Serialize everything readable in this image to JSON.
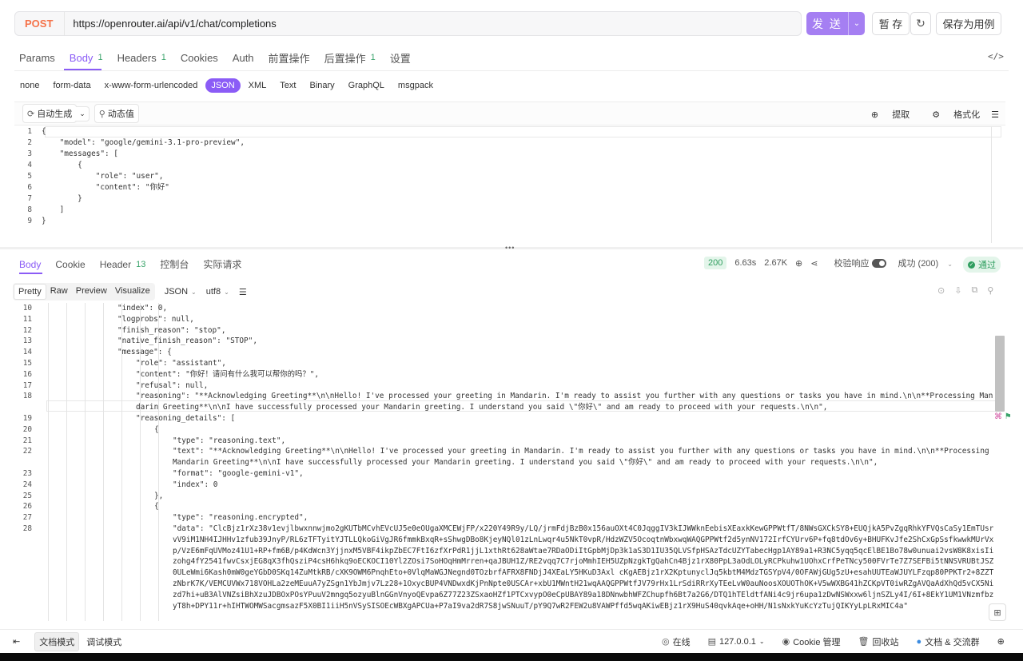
{
  "request": {
    "method": "POST",
    "url": "https://openrouter.ai/api/v1/chat/completions",
    "send_label": "发 送",
    "save_label": "暂 存",
    "save_as_label": "保存为用例"
  },
  "request_tabs": [
    {
      "label": "Params",
      "badge": ""
    },
    {
      "label": "Body",
      "badge": "1"
    },
    {
      "label": "Headers",
      "badge": "1"
    },
    {
      "label": "Cookies",
      "badge": ""
    },
    {
      "label": "Auth",
      "badge": ""
    },
    {
      "label": "前置操作",
      "badge": ""
    },
    {
      "label": "后置操作",
      "badge": "1"
    },
    {
      "label": "设置",
      "badge": ""
    }
  ],
  "body_types": [
    "none",
    "form-data",
    "x-www-form-urlencoded",
    "JSON",
    "XML",
    "Text",
    "Binary",
    "GraphQL",
    "msgpack"
  ],
  "editor_toolbar": {
    "auto_generate": "自动生成",
    "dynamic_value": "动态值",
    "extract": "提取",
    "format": "格式化"
  },
  "request_body_lines": [
    {
      "n": "1",
      "code": "{"
    },
    {
      "n": "2",
      "code": "    \"model\": \"google/gemini-3.1-pro-preview\","
    },
    {
      "n": "3",
      "code": "    \"messages\": ["
    },
    {
      "n": "4",
      "code": "        {"
    },
    {
      "n": "5",
      "code": "            \"role\": \"user\","
    },
    {
      "n": "6",
      "code": "            \"content\": \"你好\""
    },
    {
      "n": "7",
      "code": "        }"
    },
    {
      "n": "8",
      "code": "    ]"
    },
    {
      "n": "9",
      "code": "}"
    }
  ],
  "response_tabs": [
    {
      "label": "Body",
      "badge": ""
    },
    {
      "label": "Cookie",
      "badge": ""
    },
    {
      "label": "Header",
      "badge": "13"
    },
    {
      "label": "控制台",
      "badge": ""
    },
    {
      "label": "实际请求",
      "badge": ""
    }
  ],
  "response_meta": {
    "status": "200",
    "time": "6.63s",
    "size": "2.67K",
    "validate_label": "校验响应",
    "success_label": "成功 (200)",
    "pass_label": "通过"
  },
  "view_modes": [
    "Pretty",
    "Raw",
    "Preview",
    "Visualize"
  ],
  "format_select": "JSON",
  "encoding_select": "utf8",
  "response_lines": [
    {
      "n": "10",
      "indent": 5,
      "code": "\"index\": 0,"
    },
    {
      "n": "11",
      "indent": 5,
      "code": "\"logprobs\": null,"
    },
    {
      "n": "12",
      "indent": 5,
      "code": "\"finish_reason\": \"stop\","
    },
    {
      "n": "13",
      "indent": 5,
      "code": "\"native_finish_reason\": \"STOP\","
    },
    {
      "n": "14",
      "indent": 5,
      "code": "\"message\": {"
    },
    {
      "n": "15",
      "indent": 6,
      "code": "\"role\": \"assistant\","
    },
    {
      "n": "16",
      "indent": 6,
      "code": "\"content\": \"你好！请问有什么我可以帮你的吗？\","
    },
    {
      "n": "17",
      "indent": 6,
      "code": "\"refusal\": null,"
    },
    {
      "n": "18",
      "indent": 6,
      "code": "\"reasoning\": \"**Acknowledging Greeting**\\n\\nHello! I've processed your greeting in Mandarin. I'm ready to assist you further with any questions or tasks you have in mind.\\n\\n**Processing Mandarin Greeting**\\n\\nI have successfully processed your Mandarin greeting. I understand you said \\\"你好\\\" and am ready to proceed with your requests.\\n\\n\","
    },
    {
      "n": "19",
      "indent": 6,
      "code": "\"reasoning_details\": ["
    },
    {
      "n": "20",
      "indent": 7,
      "code": "{"
    },
    {
      "n": "21",
      "indent": 8,
      "code": "\"type\": \"reasoning.text\","
    },
    {
      "n": "22",
      "indent": 8,
      "code": "\"text\": \"**Acknowledging Greeting**\\n\\nHello! I've processed your greeting in Mandarin. I'm ready to assist you further with any questions or tasks you have in mind.\\n\\n**Processing Mandarin Greeting**\\n\\nI have successfully processed your Mandarin greeting. I understand you said \\\"你好\\\" and am ready to proceed with your requests.\\n\\n\","
    },
    {
      "n": "23",
      "indent": 8,
      "code": "\"format\": \"google-gemini-v1\","
    },
    {
      "n": "24",
      "indent": 8,
      "code": "\"index\": 0"
    },
    {
      "n": "25",
      "indent": 7,
      "code": "},"
    },
    {
      "n": "26",
      "indent": 7,
      "code": "{"
    },
    {
      "n": "27",
      "indent": 8,
      "code": "\"type\": \"reasoning.encrypted\","
    },
    {
      "n": "28",
      "indent": 8,
      "code": "\"data\": \"ClcBjz1rXz38v1evjlbwxnnwjmo2gKUTbMCvhEVcUJ5e0eOUgaXMCEWjFP/x220Y49R9y/LQ/jrmFdjBzB0x156auOXt4C0JqggIV3kIJWWknEebisXEaxkKewGPPWtfT/8NWsGXCkSY8+EUQjkA5PvZgqRhkYFVQsCaSy1EmTUsrvV9iM1NH4IJHHv1zfub39JnyP/RL6zTFTyitYJTLLQkoGiVgJR6fmmkBxqR+sShwgDBo8KjeyNQl01zLnLwqr4u5NkT0vpR/HdzWZV5OcoqtnWbxwqWAQGPPWtf2d5ynNV172IrfCYUrv6P+fq8tdOv6y+BHUFKvJfe2ShCxGpSsfkwwkMUrVxp/VzE6mFqUVMoz41U1+RP+fm6B/p4KdWcn3YjjnxM5VBF4ikpZbEC7FtI6zfXrPdR1jjL1xthRt628aWtae7RDaODiItGpbMjDp3k1aS3D1IU35QLVSfpHSAzTdcUZYTabecHgp1AY89a1+R3NC5yqq5qcElBE1Bo78w0unuai2vsW8K8xisIizohg4fY2541fwvCsxjEG8qX3fhQsziP4csH6hkq9oECKOCI10Yl2ZOsi7SoHOqHmMrren+qaJBUH1Z/RE2vqq7C7rjoMmhIEH5UZpNzgkTgQahCn4Bjz1rX80PpL3aOdLOLyRCPkuhw1UOhxCrfPeTNcy500FVrTe7Z7SEFBi5tNNSVRUBtJSZ0ULeWmi6Kash0mW0geYGbD0SKq14ZuMtkRB/cXK9OWM6PnqhEto+0VlqMaWGJNegnd0TOzbrfAFRX8FNDjJ4XEaLY5HKuD3Axl cKgAEBjz1rX2KptunyclJq5kbtM4MdzTGSYpV4/0OFAWjGUg5zU+esahUUTEaWJUYLFzqp80PPKTr2+8ZZTzNbrK7K/VEMCUVWx718VOHLa2zeMEuuA7yZSgn1YbJmjv7Lz28+1OxycBUP4VNDwxdKjPnNpte0USCAr+xbU1MWntH21wqAAQGPPWtfJV79rHx1LrSdiRRrXyTEeLvW0auNoosXOUOThOK+V5wWXBG41hZCKpVT0iwRZgAVQaAdXhQd5vCX5Nizd7hi+uB3AlVNZsiBhXzuJDBOxPOsYPuuV2mngq5ozyuBlnGGnVnyoQEvpa6Z77Z23ZSxaoHZf1PTCxvypO0eCpUBAY89a18DNnwbhWFZChupfh6Bt7a2G6/DTQ1hTEldtfANi4c9jr6upa1zDwNSWxxw6ljnSZLy4I/6I+8EkY1UM1VNzmfbzyT8h+DPY11r+hIHTWOMWSacgmsazF5X0BI1iiH5nVSySISOEcWBXgAPCUa+P7aI9va2dR7S8jwSNuuT/pY9Q7wR2FEW2u8VAWPffd5wqAKiwEBjz1rX9HuS40qvkAqe+oHH/N1sNxkYuKcYzTujQIKYyLpLRxMIC4a\""
    }
  ],
  "footer": {
    "doc_mode": "文档模式",
    "debug_mode": "调试模式",
    "online": "在线",
    "host": "127.0.0.1",
    "cookie_mgmt": "Cookie 管理",
    "recycle": "回收站",
    "docs_community": "文档 & 交流群"
  },
  "colors": {
    "accent": "#8b5cf6",
    "send": "#a57ff2",
    "post": "#f5734a",
    "success": "#2f9e5f"
  }
}
